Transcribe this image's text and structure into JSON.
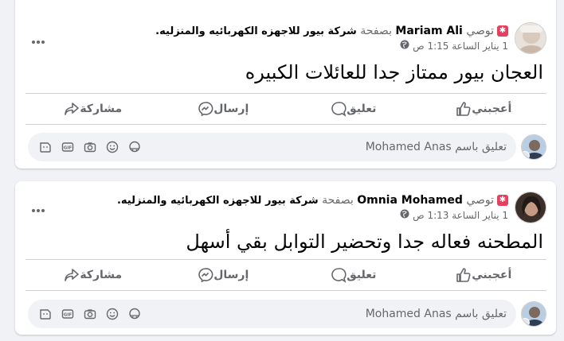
{
  "posts": [
    {
      "badge_label": "توصي",
      "author": "Mariam Ali",
      "via": "بصفحة",
      "page_name": "شركة بيور للاجهزه الكهربائيه والمنزليه",
      "date": "1 يناير الساعة 1:15 ص",
      "text": "العجان بيور ممتاز جدا للعائلات الكبيره",
      "actions": {
        "like": "أعجبني",
        "comment": "تعليق",
        "send": "إرسال",
        "share": "مشاركة"
      },
      "comment_placeholder": "تعليق باسم Mohamed Anas"
    },
    {
      "badge_label": "توصي",
      "author": "Omnia Mohamed",
      "via": "بصفحة",
      "page_name": "شركة بيور للاجهزه الكهربائيه والمنزليه",
      "date": "1 يناير الساعة 1:13 ص",
      "text": "المطحنه فعاله جدا وتحضير التوابل بقي أسهل",
      "actions": {
        "like": "أعجبني",
        "comment": "تعليق",
        "send": "إرسال",
        "share": "مشاركة"
      },
      "comment_placeholder": "تعليق باسم Mohamed Anas"
    }
  ],
  "icons": [
    "more-icon",
    "recommend-badge-icon",
    "globe-icon",
    "like-icon",
    "comment-icon",
    "messenger-icon",
    "share-icon",
    "sticker-icon",
    "gif-icon",
    "camera-icon",
    "emoji-icon",
    "avatar-sticker-icon"
  ],
  "colors": {
    "background": "#f0f2f5",
    "card": "#ffffff",
    "secondary_text": "#65676b",
    "badge": "#e4405f",
    "divider": "#ced0d4"
  }
}
